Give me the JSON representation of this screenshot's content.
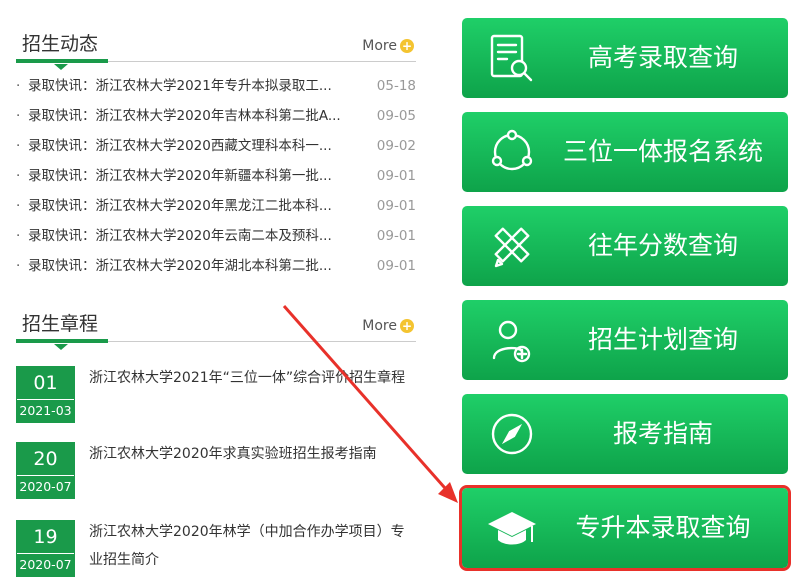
{
  "dynamics": {
    "title": "招生动态",
    "more": "More",
    "items": [
      {
        "text": "录取快讯：浙江农林大学2021年专升本拟录取工...",
        "date": "05-18"
      },
      {
        "text": "录取快讯：浙江农林大学2020年吉林本科第二批A...",
        "date": "09-05"
      },
      {
        "text": "录取快讯：浙江农林大学2020西藏文理科本科一...",
        "date": "09-02"
      },
      {
        "text": "录取快讯：浙江农林大学2020年新疆本科第一批...",
        "date": "09-01"
      },
      {
        "text": "录取快讯：浙江农林大学2020年黑龙江二批本科...",
        "date": "09-01"
      },
      {
        "text": "录取快讯：浙江农林大学2020年云南二本及预科...",
        "date": "09-01"
      },
      {
        "text": "录取快讯：浙江农林大学2020年湖北本科第二批...",
        "date": "09-01"
      }
    ]
  },
  "rules": {
    "title": "招生章程",
    "more": "More",
    "items": [
      {
        "day": "01",
        "ym": "2021-03",
        "text": "浙江农林大学2021年“三位一体”综合评价招生章程"
      },
      {
        "day": "20",
        "ym": "2020-07",
        "text": "浙江农林大学2020年求真实验班招生报考指南"
      },
      {
        "day": "19",
        "ym": "2020-07",
        "text": "浙江农林大学2020年林学（中加合作办学项目）专业招生简介"
      }
    ]
  },
  "quick_links": [
    {
      "label": "高考录取查询",
      "icon": "document-search-icon"
    },
    {
      "label": "三位一体报名系统",
      "icon": "cycle-icon"
    },
    {
      "label": "往年分数查询",
      "icon": "pencil-ruler-icon"
    },
    {
      "label": "招生计划查询",
      "icon": "user-add-icon"
    },
    {
      "label": "报考指南",
      "icon": "compass-icon"
    },
    {
      "label": "专升本录取查询",
      "icon": "graduation-cap-icon"
    }
  ],
  "colors": {
    "accent": "#1a9a4a",
    "button": "#12b856",
    "highlight": "#e8312a",
    "more_icon": "#f4c430"
  }
}
